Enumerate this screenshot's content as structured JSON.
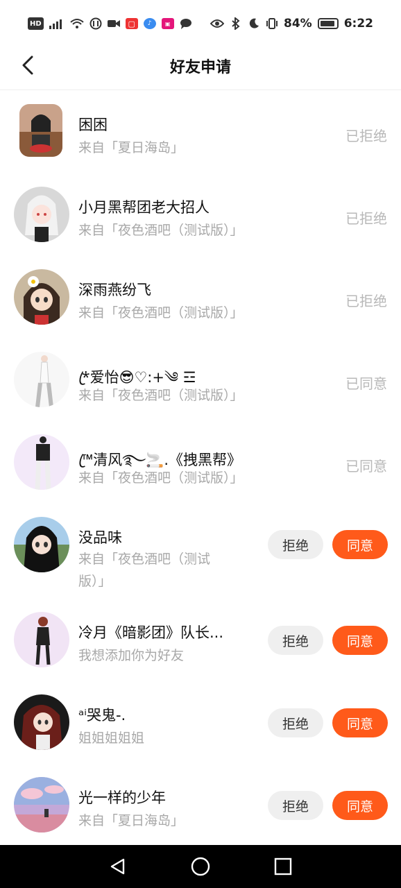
{
  "status_bar": {
    "left_icons": [
      "hd-icon",
      "signal-icon",
      "wifi-icon",
      "data-icon",
      "video-icon",
      "app-red-icon",
      "music-icon",
      "app-pink-icon",
      "chat-icon"
    ],
    "battery": "84%",
    "time": "6:22"
  },
  "header": {
    "title": "好友申请"
  },
  "requests": [
    {
      "name": "困困",
      "source": "来自「夏日海岛」",
      "status": "已拒绝"
    },
    {
      "name": "小月黑帮团老大招人",
      "source": "来自「夜色酒吧（测试版）」",
      "status": "已拒绝"
    },
    {
      "name": "深雨燕纷飞",
      "source": "来自「夜色酒吧（测试版）」",
      "status": "已拒绝"
    },
    {
      "name": "*ꦿ爱怡😎♡:+༄ ☲",
      "source": "来自「夜色酒吧（测试版）」",
      "status": "已同意"
    },
    {
      "name": "™ꦿ清风࿐🚬.《拽黑帮》",
      "source": "来自「夜色酒吧（测试版）」",
      "status": "已同意"
    },
    {
      "name": "没品味",
      "source": "来自「夜色酒吧（测试",
      "source2": "版）」",
      "reject": "拒绝",
      "accept": "同意"
    },
    {
      "name": "冷月《暗影团》队长...",
      "source": "我想添加你为好友",
      "reject": "拒绝",
      "accept": "同意"
    },
    {
      "name": "ᵃⁱ哭鬼-.",
      "source": "姐姐姐姐姐",
      "reject": "拒绝",
      "accept": "同意"
    },
    {
      "name": "光一样的少年",
      "source": "来自「夏日海岛」",
      "reject": "拒绝",
      "accept": "同意"
    }
  ],
  "colors": {
    "accent": "#ff5a1a",
    "muted": "#a8a8a8",
    "reject_bg": "#efefef"
  }
}
